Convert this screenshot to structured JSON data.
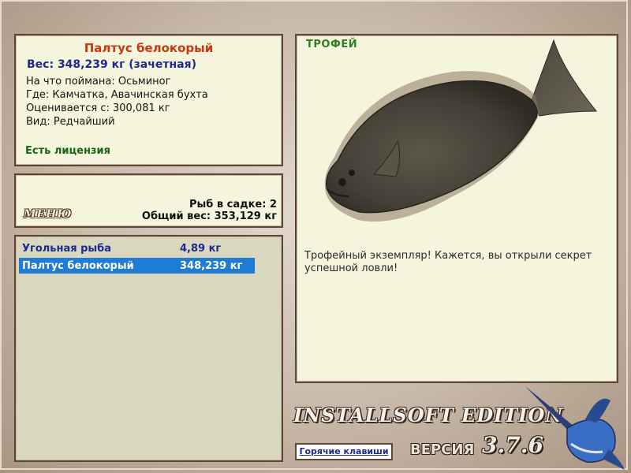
{
  "catch": {
    "title": "Палтус белокорый",
    "weight": "Вес: 348,239 кг (зачетная)",
    "bait": "На что поймана: Осьминог",
    "place": "Где: Камчатка, Авачинская бухта",
    "value": "Оценивается с: 300,081 кг",
    "kind": "Вид: Редчайший",
    "license": "Есть лицензия"
  },
  "summary": {
    "menu_label": "МЕНЮ",
    "count": "Рыб в садке: 2",
    "total_weight": "Общий вес: 353,129 кг"
  },
  "list": [
    {
      "name": "Угольная рыба",
      "weight": "4,89 кг",
      "selected": false
    },
    {
      "name": "Палтус белокорый",
      "weight": "348,239 кг",
      "selected": true
    }
  ],
  "trophy": {
    "label": "ТРОФЕЙ",
    "message": "Трофейный экземпляр! Кажется, вы открыли секрет успешной ловли!"
  },
  "footer": {
    "edition": "INSTALLSOFT EDITION",
    "version_label": "ВЕРСИЯ",
    "version_number": "3.7.6",
    "hotkeys": "Горячие клавиши"
  },
  "colors": {
    "title": "#c63812",
    "weight": "#1f2a8e",
    "license": "#166612",
    "selection": "#1f7bd3"
  }
}
